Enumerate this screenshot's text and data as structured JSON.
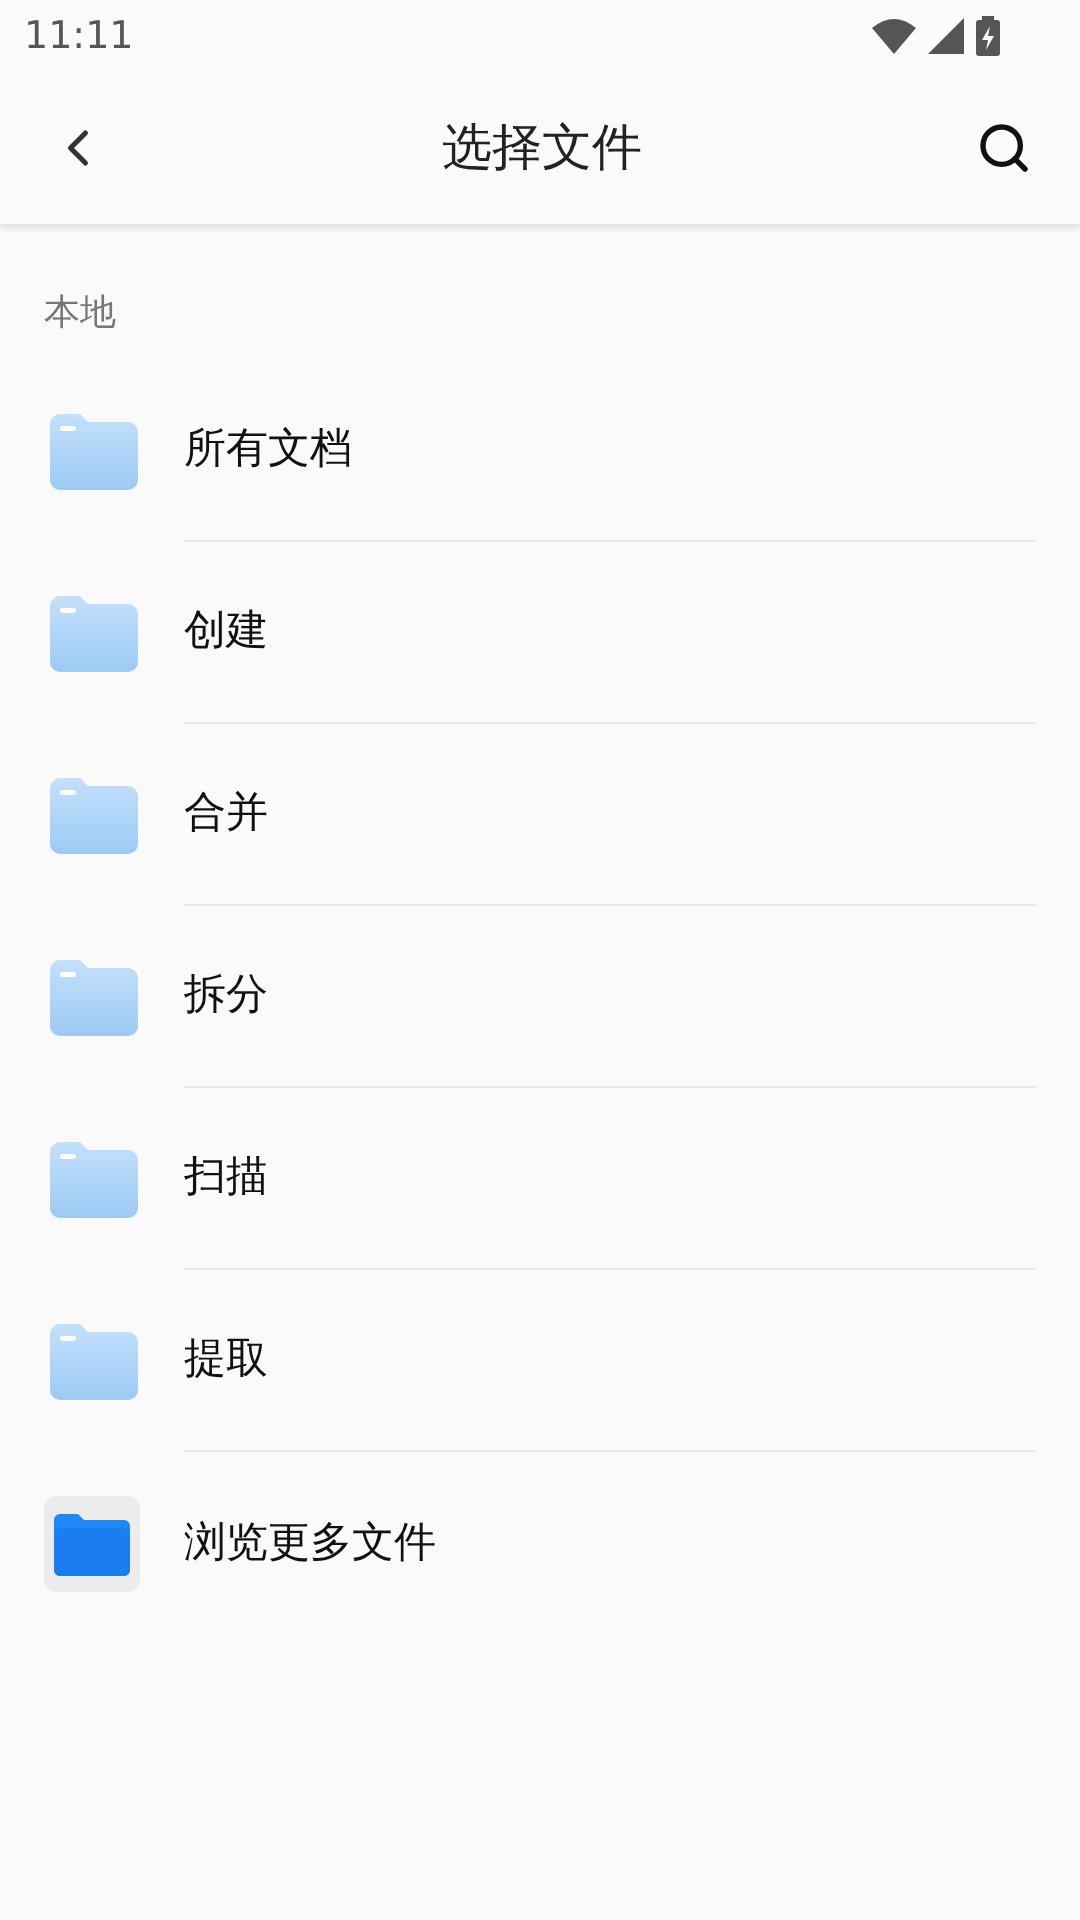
{
  "status_bar": {
    "time": "11:11"
  },
  "header": {
    "title": "选择文件"
  },
  "section": {
    "label": "本地"
  },
  "items": [
    {
      "label": "所有文档",
      "kind": "folder"
    },
    {
      "label": "创建",
      "kind": "folder"
    },
    {
      "label": "合并",
      "kind": "folder"
    },
    {
      "label": "拆分",
      "kind": "folder"
    },
    {
      "label": "扫描",
      "kind": "folder"
    },
    {
      "label": "提取",
      "kind": "folder"
    },
    {
      "label": "浏览更多文件",
      "kind": "app"
    }
  ]
}
